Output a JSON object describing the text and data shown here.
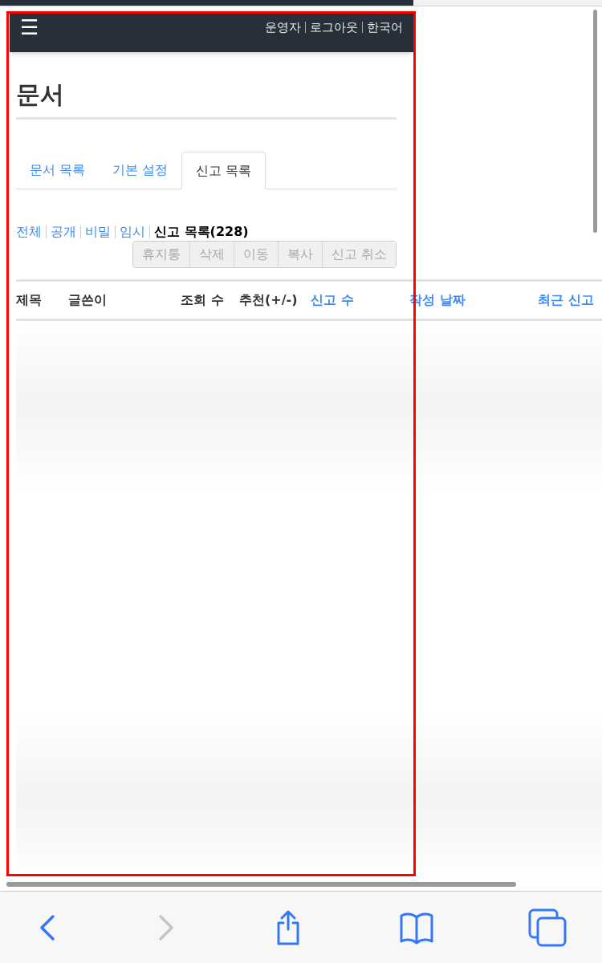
{
  "header": {
    "menu_icon": "☰",
    "links": [
      "운영자",
      "로그아웃",
      "한국어"
    ]
  },
  "page_title": "문서",
  "tabs": [
    {
      "label": "문서 목록",
      "selected": false
    },
    {
      "label": "기본 설정",
      "selected": false
    },
    {
      "label": "신고 목록",
      "selected": true
    }
  ],
  "filters": [
    {
      "label": "전체",
      "selected": false
    },
    {
      "label": "공개",
      "selected": false
    },
    {
      "label": "비밀",
      "selected": false
    },
    {
      "label": "임시",
      "selected": false
    },
    {
      "label": "신고 목록(228)",
      "selected": true
    }
  ],
  "action_buttons": [
    {
      "label": "휴지통",
      "disabled": true
    },
    {
      "label": "삭제",
      "disabled": true
    },
    {
      "label": "이동",
      "disabled": true
    },
    {
      "label": "복사",
      "disabled": true
    },
    {
      "label": "신고 취소",
      "disabled": true
    }
  ],
  "table": {
    "columns": [
      {
        "label": "제목",
        "sortable": false
      },
      {
        "label": "글쓴이",
        "sortable": false
      },
      {
        "label": "조회 수",
        "sortable": false
      },
      {
        "label": "추천(+/-)",
        "sortable": false
      },
      {
        "label": "신고 수",
        "sortable": true
      },
      {
        "label": "작성 날짜",
        "sortable": true
      },
      {
        "label": "최근 신고",
        "sortable": true
      }
    ]
  },
  "toolbar": [
    {
      "kind": "back",
      "disabled": false
    },
    {
      "kind": "forward",
      "disabled": true
    },
    {
      "kind": "share",
      "disabled": false
    },
    {
      "kind": "bookmarks",
      "disabled": false
    },
    {
      "kind": "tabs",
      "disabled": false
    }
  ]
}
